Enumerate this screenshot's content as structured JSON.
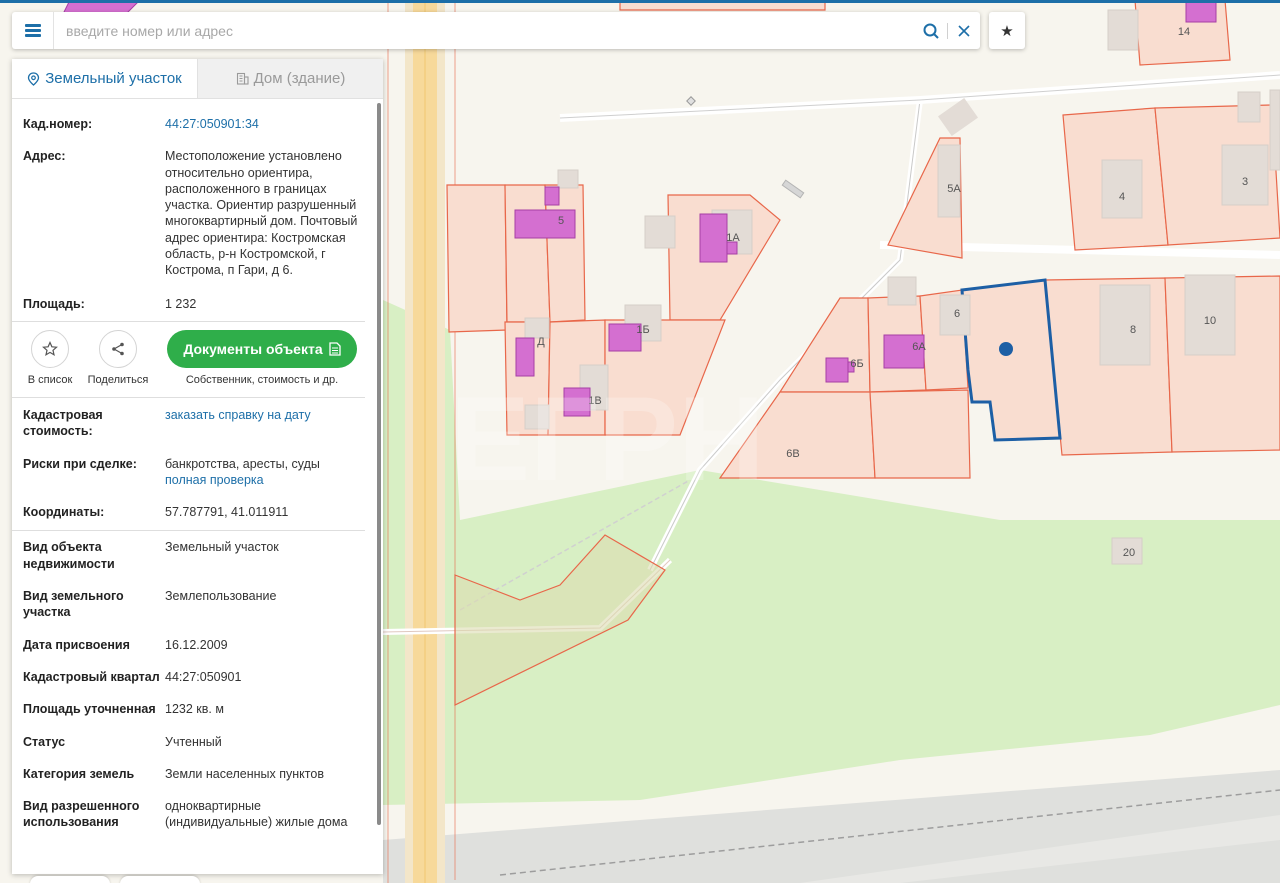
{
  "search": {
    "placeholder": "введите номер или адрес",
    "menu_icon": "hamburger-icon",
    "search_icon": "magnifier-icon",
    "clear_icon": "close-icon",
    "favorite_icon": "star-icon"
  },
  "tabs": [
    {
      "label": "Земельный участок",
      "icon": "location-pin-icon",
      "active": true
    },
    {
      "label": "Дом (здание)",
      "icon": "building-icon",
      "active": false
    }
  ],
  "info": {
    "cad_number_label": "Кад.номер:",
    "cad_number_value": "44:27:050901:34",
    "address_label": "Адрес:",
    "address_value": "Местоположение установлено относительно ориентира, расположенного в границах участка. Ориентир разрушенный многоквартирный дом. Почтовый адрес ориентира: Костромская область, р-н Костромской, г Кострома, п Гари, д 6.",
    "area_label": "Площадь:",
    "area_value": "1 232"
  },
  "actions": {
    "add_to_list": "В список",
    "share": "Поделиться",
    "documents_button": "Документы объекта",
    "documents_caption": "Собственник, стоимость и др."
  },
  "details": {
    "cad_value_label": "Кадастровая стоимость:",
    "cad_value_link": "заказать справку на дату",
    "risks_label": "Риски при сделке:",
    "risks_value": "банкротства, аресты, суды",
    "risks_link": "полная проверка",
    "coords_label": "Координаты:",
    "coords_value": "57.787791, 41.011911"
  },
  "properties": [
    {
      "label": "Вид объекта недвижимости",
      "value": "Земельный участок"
    },
    {
      "label": "Вид земельного участка",
      "value": "Землепользование"
    },
    {
      "label": "Дата присвоения",
      "value": "16.12.2009"
    },
    {
      "label": "Кадастровый квартал",
      "value": "44:27:050901"
    },
    {
      "label": "Площадь уточненная",
      "value": "1232 кв. м"
    },
    {
      "label": "Статус",
      "value": "Учтенный"
    },
    {
      "label": "Категория земель",
      "value": "Земли населенных пунктов"
    },
    {
      "label": "Вид разрешенного использования",
      "value": "одноквартирные (индивидуальные) жилые дома"
    }
  ],
  "map_labels": [
    "14",
    "5А",
    "4",
    "3",
    "5",
    "1А",
    "Д",
    "1Б",
    "1В",
    "6",
    "6А",
    "6Б",
    "8",
    "10",
    "6В",
    "20"
  ],
  "colors": {
    "accent": "#1d6fa8",
    "parcel_fill": "#f9ddd0",
    "parcel_border": "#e8674a",
    "building": "#d46fd0",
    "selected_border": "#1d5fa5",
    "green_area": "#d8efc4",
    "road": "#f6d99b"
  }
}
